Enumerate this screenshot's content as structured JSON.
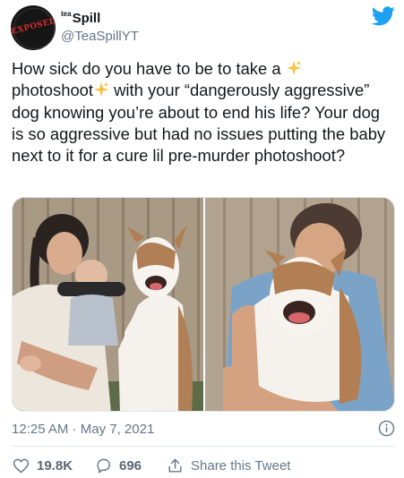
{
  "author": {
    "name": "Spill",
    "name_prefix": "tea",
    "handle": "@TeaSpillYT",
    "avatar_text": "EXPOSED"
  },
  "tweet": {
    "line1": "How sick do you have to be to take a ",
    "line2": "photoshoot",
    "line3": " with your “dangerously aggressive” dog knowing you’re about to end his life? Your dog is so aggressive but had no issues putting the baby next to it for a cure lil pre-murder photoshoot?"
  },
  "meta": {
    "time": "12:25 AM",
    "date": "May 7, 2021"
  },
  "actions": {
    "likes": "19.8K",
    "replies": "696",
    "share_label": "Share this Tweet"
  },
  "colors": {
    "twitter_blue": "#1da1f2",
    "secondary_text": "#657786",
    "sparkle": "#f5c242"
  },
  "icons": [
    "twitter-bird-icon",
    "sparkles-icon",
    "info-icon",
    "heart-icon",
    "reply-icon",
    "share-icon"
  ]
}
